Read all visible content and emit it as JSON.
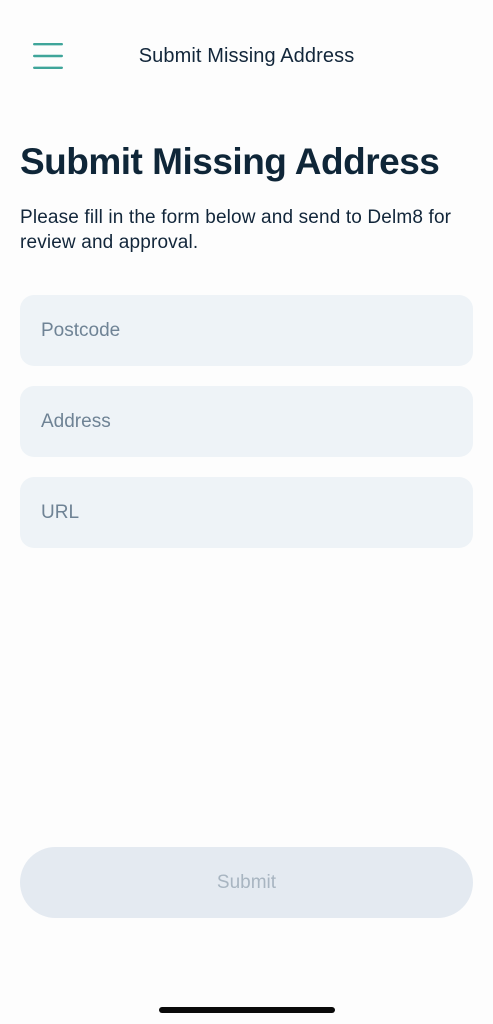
{
  "header": {
    "title": "Submit Missing Address",
    "menu_icon": "hamburger-menu-icon",
    "menu_icon_color": "#3fa59a"
  },
  "main": {
    "title": "Submit Missing Address",
    "description": "Please fill in the form below and send to Delm8 for review and approval.",
    "fields": [
      {
        "name": "postcode",
        "value": "",
        "placeholder": "Postcode"
      },
      {
        "name": "address",
        "value": "",
        "placeholder": "Address"
      },
      {
        "name": "url",
        "value": "",
        "placeholder": "URL"
      }
    ],
    "submit_label": "Submit",
    "submit_disabled": true
  },
  "colors": {
    "text_primary": "#12263a",
    "field_background": "#eef3f7",
    "placeholder": "#6f8395",
    "button_disabled_bg": "#e4eaf1",
    "button_disabled_text": "#a8b5c1"
  }
}
